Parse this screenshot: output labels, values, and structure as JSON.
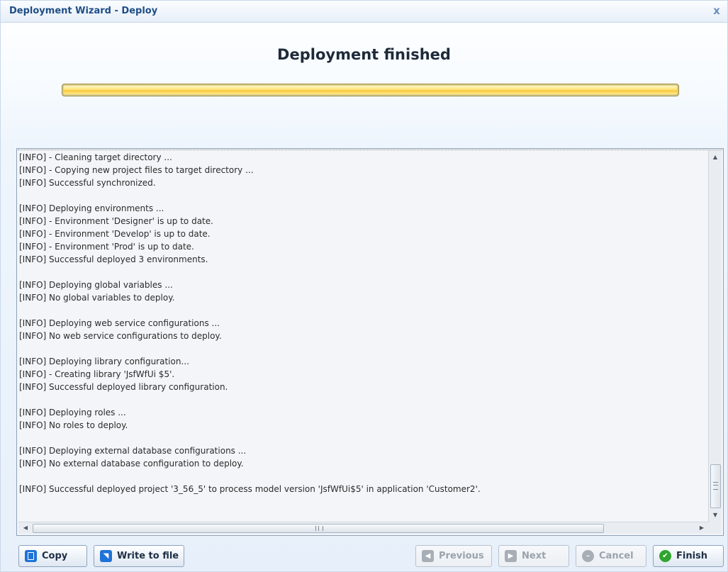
{
  "window": {
    "title": "Deployment Wizard - Deploy",
    "close_glyph": "x"
  },
  "heading": "Deployment finished",
  "progress": {
    "value": 1.0
  },
  "log": {
    "lines": [
      "[INFO] - Cleaning target directory ...",
      "[INFO] - Copying new project files to target directory ...",
      "[INFO] Successful synchronized.",
      "",
      "[INFO] Deploying environments ...",
      "[INFO] - Environment 'Designer' is up to date.",
      "[INFO] - Environment 'Develop' is up to date.",
      "[INFO] - Environment 'Prod' is up to date.",
      "[INFO] Successful deployed 3 environments.",
      "",
      "[INFO] Deploying global variables ...",
      "[INFO] No global variables to deploy.",
      "",
      "[INFO] Deploying web service configurations ...",
      "[INFO] No web service configurations to deploy.",
      "",
      "[INFO] Deploying library configuration...",
      "[INFO] - Creating library 'JsfWfUi $5'.",
      "[INFO] Successful deployed library configuration.",
      "",
      "[INFO] Deploying roles ...",
      "[INFO] No roles to deploy.",
      "",
      "[INFO] Deploying external database configurations ...",
      "[INFO] No external database configuration to deploy.",
      "",
      "[INFO] Successful deployed project '3_56_5' to process model version 'JsfWfUi$5' in application 'Customer2'."
    ]
  },
  "buttons": {
    "copy": {
      "label": "Copy",
      "icon": "copy-icon",
      "enabled": true
    },
    "write_to_file": {
      "label": "Write to file",
      "icon": "write-file-icon",
      "enabled": true
    },
    "previous": {
      "label": "Previous",
      "icon": "arrow-left-icon",
      "enabled": false
    },
    "next": {
      "label": "Next",
      "icon": "arrow-right-icon",
      "enabled": false
    },
    "cancel": {
      "label": "Cancel",
      "icon": "cancel-icon",
      "enabled": false
    },
    "finish": {
      "label": "Finish",
      "icon": "check-icon",
      "enabled": true
    }
  },
  "colors": {
    "title": "#1f4e86",
    "progress_fill": "#ffe27a",
    "finish_icon": "#2fa52f",
    "primary_icon": "#1e73d8"
  }
}
